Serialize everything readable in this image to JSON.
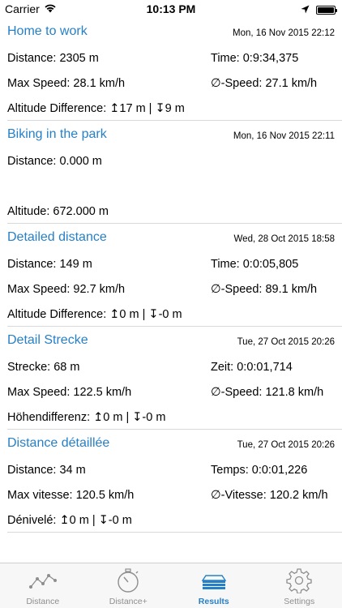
{
  "status_bar": {
    "carrier": "Carrier",
    "time": "10:13 PM",
    "battery_level": 1.0
  },
  "results": [
    {
      "title": "Home to work",
      "date": "Mon, 16 Nov 2015 22:12",
      "row1_left": "Distance: 2305 m",
      "row1_right": "Time: 0:9:34,375",
      "row2_left": "Max Speed: 28.1 km/h",
      "row2_right": "∅-Speed: 27.1 km/h",
      "row3_left": "Altitude Difference: ↥17 m | ↧9 m"
    },
    {
      "title": "Biking in the park",
      "date": "Mon, 16 Nov 2015 22:11",
      "row1_left": "Distance: 0.000 m",
      "row1_right": "",
      "row2_left": "",
      "row2_right": "",
      "row3_left": "Altitude: 672.000 m"
    },
    {
      "title": "Detailed distance",
      "date": "Wed, 28 Oct 2015 18:58",
      "row1_left": "Distance: 149 m",
      "row1_right": "Time: 0:0:05,805",
      "row2_left": "Max Speed: 92.7 km/h",
      "row2_right": "∅-Speed: 89.1 km/h",
      "row3_left": "Altitude Difference: ↥0 m | ↧-0 m"
    },
    {
      "title": "Detail Strecke",
      "date": "Tue, 27 Oct 2015 20:26",
      "row1_left": "Strecke: 68 m",
      "row1_right": "Zeit: 0:0:01,714",
      "row2_left": "Max Speed: 122.5 km/h",
      "row2_right": "∅-Speed: 121.8 km/h",
      "row3_left": "Höhendifferenz: ↥0 m | ↧-0 m"
    },
    {
      "title": "Distance détaillée",
      "date": "Tue, 27 Oct 2015 20:26",
      "row1_left": "Distance: 34 m",
      "row1_right": "Temps: 0:0:01,226",
      "row2_left": "Max vitesse: 120.5 km/h",
      "row2_right": "∅-Vitesse: 120.2 km/h",
      "row3_left": "Dénivelé: ↥0 m | ↧-0 m"
    }
  ],
  "tabs": [
    {
      "label": "Distance",
      "icon": "line-graph-icon",
      "active": false
    },
    {
      "label": "Distance+",
      "icon": "stopwatch-icon",
      "active": false
    },
    {
      "label": "Results",
      "icon": "stacked-layers-icon",
      "active": true
    },
    {
      "label": "Settings",
      "icon": "gear-icon",
      "active": false
    }
  ],
  "colors": {
    "accent": "#2680c8",
    "inactive": "#8e8e8e",
    "separator": "#d9d9d9"
  }
}
